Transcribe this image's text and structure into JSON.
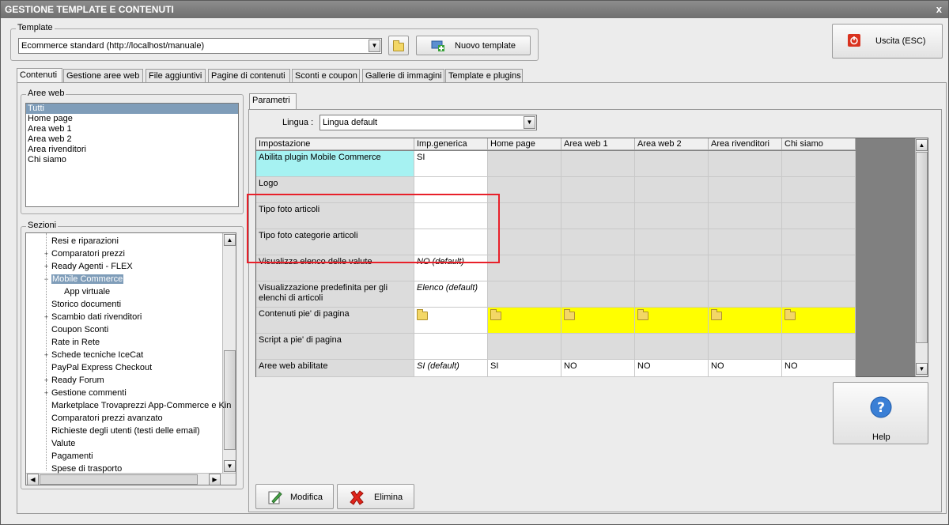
{
  "window": {
    "title": "GESTIONE TEMPLATE E CONTENUTI",
    "close_glyph": "x"
  },
  "template": {
    "group_label": "Template",
    "selected": "Ecommerce standard (http://localhost/manuale)",
    "new_button": "Nuovo template"
  },
  "exit_button": "Uscita (ESC)",
  "tabs": [
    "Contenuti",
    "Gestione aree web",
    "File aggiuntivi",
    "Pagine di contenuti",
    "Sconti e coupon",
    "Gallerie di immagini",
    "Template e plugins"
  ],
  "aree_web": {
    "label": "Aree web",
    "items": [
      "Tutti",
      "Home page",
      "Area web 1",
      "Area web 2",
      "Area rivenditori",
      "Chi siamo"
    ],
    "selected_index": 0
  },
  "sezioni": {
    "label": "Sezioni",
    "items": [
      {
        "label": "Resi e riparazioni",
        "expander": "",
        "indent": 0
      },
      {
        "label": "Comparatori prezzi",
        "expander": "+",
        "indent": 0
      },
      {
        "label": "Ready Agenti - FLEX",
        "expander": "+",
        "indent": 0
      },
      {
        "label": "Mobile Commerce",
        "expander": "−",
        "indent": 0,
        "selected": true
      },
      {
        "label": "App virtuale",
        "expander": "",
        "indent": 1
      },
      {
        "label": "Storico documenti",
        "expander": "",
        "indent": 0
      },
      {
        "label": "Scambio dati rivenditori",
        "expander": "+",
        "indent": 0
      },
      {
        "label": "Coupon Sconti",
        "expander": "",
        "indent": 0
      },
      {
        "label": "Rate in Rete",
        "expander": "",
        "indent": 0
      },
      {
        "label": "Schede tecniche IceCat",
        "expander": "+",
        "indent": 0
      },
      {
        "label": "PayPal Express Checkout",
        "expander": "",
        "indent": 0
      },
      {
        "label": "Ready Forum",
        "expander": "+",
        "indent": 0
      },
      {
        "label": "Gestione commenti",
        "expander": "+",
        "indent": 0
      },
      {
        "label": "Marketplace Trovaprezzi App-Commerce e Kin",
        "expander": "",
        "indent": 0
      },
      {
        "label": "Comparatori prezzi avanzato",
        "expander": "",
        "indent": 0
      },
      {
        "label": "Richieste degli utenti (testi delle email)",
        "expander": "",
        "indent": 0
      },
      {
        "label": "Valute",
        "expander": "",
        "indent": 0
      },
      {
        "label": "Pagamenti",
        "expander": "",
        "indent": 0
      },
      {
        "label": "Spese di trasporto",
        "expander": "",
        "indent": 0
      }
    ]
  },
  "parametri": {
    "tab": "Parametri",
    "lingua_label": "Lingua :",
    "lingua_value": "Lingua default",
    "columns": [
      "Impostazione",
      "Imp.generica",
      "Home page",
      "Area web 1",
      "Area web 2",
      "Area rivenditori",
      "Chi siamo"
    ],
    "rows": [
      {
        "name": "Abilita plugin Mobile Commerce",
        "style": "cyan",
        "values": [
          "SI",
          "",
          "",
          "",
          "",
          ""
        ],
        "types": [
          "w",
          "g",
          "g",
          "g",
          "g",
          "g"
        ]
      },
      {
        "name": "Logo",
        "style": "",
        "values": [
          "",
          "",
          "",
          "",
          "",
          ""
        ],
        "types": [
          "w",
          "g",
          "g",
          "g",
          "g",
          "g"
        ]
      },
      {
        "name": "Tipo foto articoli",
        "style": "",
        "values": [
          "",
          "",
          "",
          "",
          "",
          ""
        ],
        "types": [
          "w",
          "g",
          "g",
          "g",
          "g",
          "g"
        ]
      },
      {
        "name": "Tipo foto categorie articoli",
        "style": "",
        "values": [
          "",
          "",
          "",
          "",
          "",
          ""
        ],
        "types": [
          "w",
          "g",
          "g",
          "g",
          "g",
          "g"
        ]
      },
      {
        "name": "Visualizza elenco delle valute",
        "style": "",
        "values": [
          "NO (default)",
          "",
          "",
          "",
          "",
          ""
        ],
        "types": [
          "wi",
          "g",
          "g",
          "g",
          "g",
          "g"
        ]
      },
      {
        "name": "Visualizzazione predefinita per gli elenchi di articoli",
        "style": "",
        "values": [
          "Elenco (default)",
          "",
          "",
          "",
          "",
          ""
        ],
        "types": [
          "wi",
          "g",
          "g",
          "g",
          "g",
          "g"
        ]
      },
      {
        "name": "Contenuti pie' di pagina",
        "style": "",
        "values": [
          "",
          "",
          "",
          "",
          "",
          ""
        ],
        "types": [
          "wf",
          "yf",
          "yf",
          "yf",
          "yf",
          "yf"
        ]
      },
      {
        "name": "Script a pie' di pagina",
        "style": "",
        "values": [
          "",
          "",
          "",
          "",
          "",
          ""
        ],
        "types": [
          "w",
          "g",
          "g",
          "g",
          "g",
          "g"
        ]
      },
      {
        "name": "Aree web abilitate",
        "style": "",
        "values": [
          "SI (default)",
          "SI",
          "NO",
          "NO",
          "NO",
          "NO"
        ],
        "types": [
          "wi",
          "w",
          "w",
          "w",
          "w",
          "w"
        ]
      }
    ]
  },
  "buttons": {
    "modifica": "Modifica",
    "elimina": "Elimina",
    "help": "Help"
  },
  "icons": {
    "folder": "folder-icon",
    "exit": "power-icon",
    "help": "help-icon",
    "new_template": "add-template-icon",
    "edit": "edit-icon",
    "delete": "delete-icon"
  },
  "colors": {
    "titlebar": "#7a7a7a",
    "selection": "#7f9db9",
    "highlight_row": "#ffff00",
    "cyan_cell": "#a6f2f2",
    "red_box": "#e8202a"
  }
}
